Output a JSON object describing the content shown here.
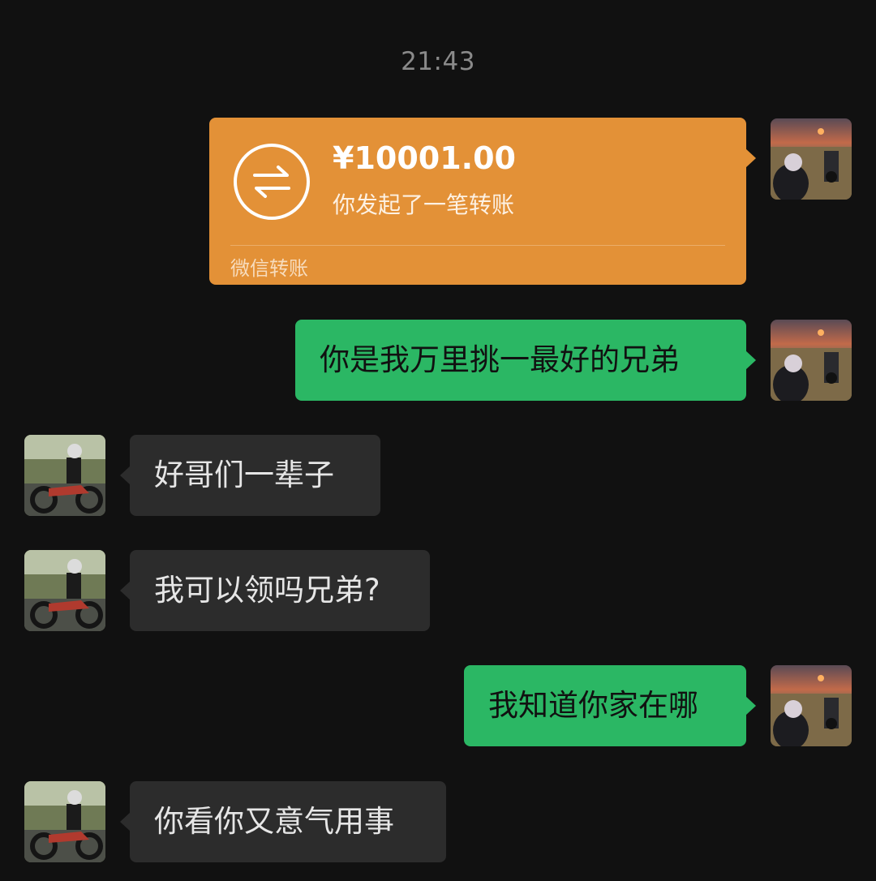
{
  "chat": {
    "timestamp": "21:43",
    "transfer": {
      "amount": "¥10001.00",
      "description": "你发起了一笔转账",
      "footer": "微信转账"
    },
    "messages": [
      {
        "side": "out",
        "text": "你是我万里挑一最好的兄弟"
      },
      {
        "side": "in",
        "text": "好哥们一辈子"
      },
      {
        "side": "in",
        "text": "我可以领吗兄弟?"
      },
      {
        "side": "out",
        "text": "我知道你家在哪"
      },
      {
        "side": "in",
        "text": "你看你又意气用事"
      }
    ]
  },
  "colors": {
    "background": "#111111",
    "incoming_bubble": "#2c2c2c",
    "outgoing_bubble": "#2bb764",
    "transfer_card": "#e39137"
  },
  "icons": {
    "transfer": "transfer-arrows-icon",
    "self_avatar": "avatar-sunset-motorcycle",
    "friend_avatar": "avatar-motorcycle-rider"
  }
}
